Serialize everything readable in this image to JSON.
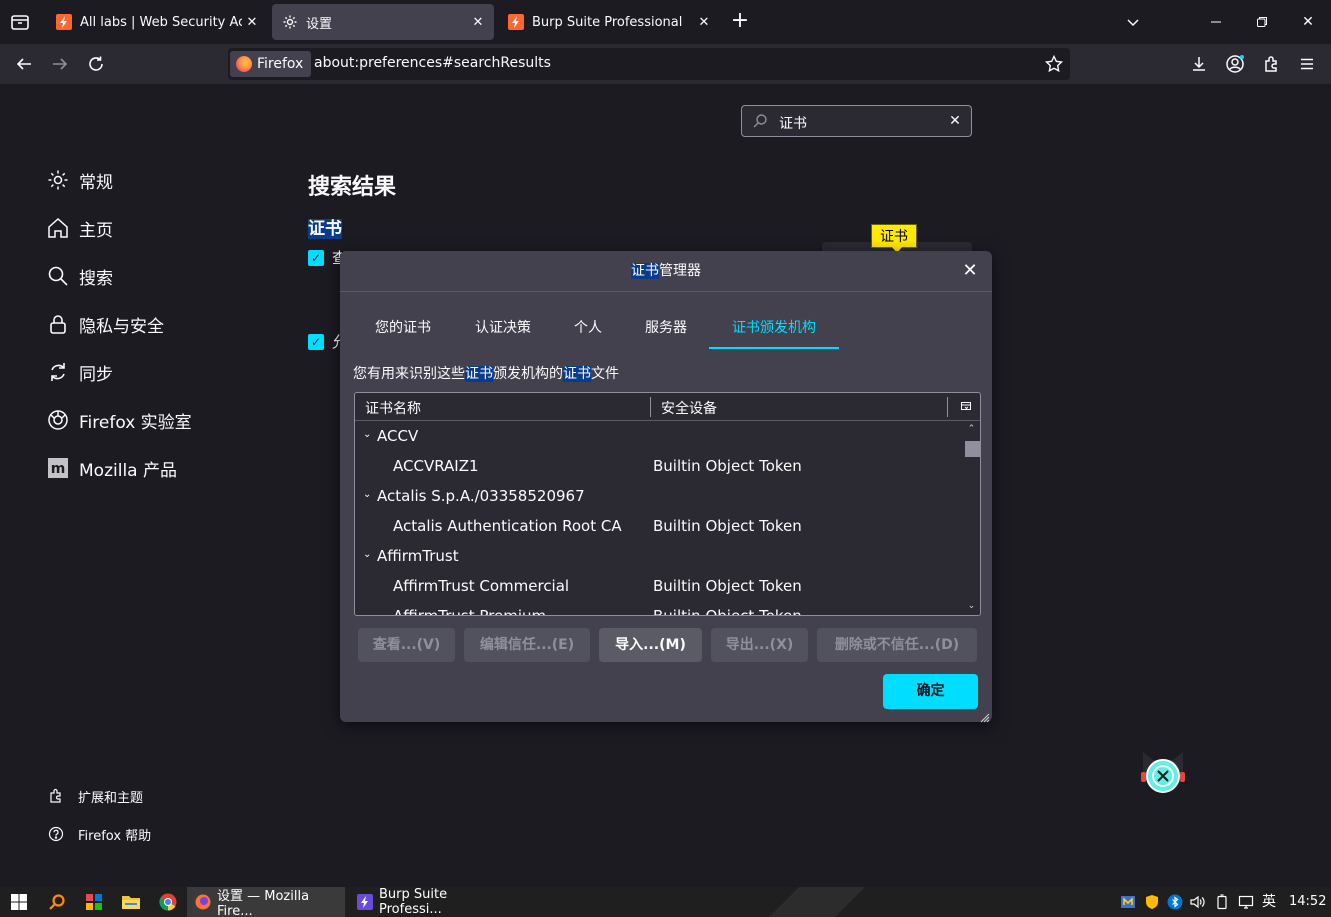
{
  "browser": {
    "tabs": [
      {
        "title": "All labs | Web Security Acade",
        "active": false
      },
      {
        "title": "设置",
        "active": true
      },
      {
        "title": "Burp Suite Professional",
        "active": false
      }
    ],
    "identity_label": "Firefox",
    "url": "about:preferences#searchResults"
  },
  "prefs": {
    "search_value": "证书",
    "sidebar": [
      {
        "label": "常规",
        "icon": "gear-icon"
      },
      {
        "label": "主页",
        "icon": "home-icon"
      },
      {
        "label": "搜索",
        "icon": "search-icon"
      },
      {
        "label": "隐私与安全",
        "icon": "lock-icon"
      },
      {
        "label": "同步",
        "icon": "sync-icon"
      },
      {
        "label": "Firefox 实验室",
        "icon": "labs-icon"
      },
      {
        "label": "Mozilla 产品",
        "icon": "mozilla-icon"
      }
    ],
    "footer": [
      {
        "label": "扩展和主题",
        "icon": "puzzle-icon"
      },
      {
        "label": "Firefox 帮助",
        "icon": "help-icon"
      }
    ],
    "results_title": "搜索结果",
    "cert_heading": "证书",
    "check1_label": "查",
    "check2_label": "允",
    "tooltip": "证书"
  },
  "dialog": {
    "title_hl": "证书",
    "title_rest": "管理器",
    "tabs": [
      "您的证书",
      "认证决策",
      "个人",
      "服务器",
      "证书颁发机构"
    ],
    "selected_tab": 4,
    "desc": {
      "a": "您有用来识别这些",
      "hl1": "证书",
      "b": "颁发机构的",
      "hl2": "证书",
      "c": "文件"
    },
    "columns": [
      "证书名称",
      "安全设备"
    ],
    "rows": [
      {
        "type": "group",
        "name": "ACCV",
        "device": ""
      },
      {
        "type": "item",
        "name": "ACCVRAIZ1",
        "device": "Builtin Object Token"
      },
      {
        "type": "group",
        "name": "Actalis S.p.A./03358520967",
        "device": ""
      },
      {
        "type": "item",
        "name": "Actalis Authentication Root CA",
        "device": "Builtin Object Token"
      },
      {
        "type": "group",
        "name": "AffirmTrust",
        "device": ""
      },
      {
        "type": "item",
        "name": "AffirmTrust Commercial",
        "device": "Builtin Object Token"
      },
      {
        "type": "item",
        "name": "AffirmTrust Premium",
        "device": "Builtin Object Token"
      }
    ],
    "buttons": [
      {
        "label": "查看...(V)",
        "enabled": false
      },
      {
        "label": "编辑信任...(E)",
        "enabled": false
      },
      {
        "label": "导入...(M)",
        "enabled": true
      },
      {
        "label": "导出...(X)",
        "enabled": false
      },
      {
        "label": "删除或不信任...(D)",
        "enabled": false
      }
    ],
    "ok_label": "确定"
  },
  "taskbar": {
    "apps": [
      {
        "label": "设置 — Mozilla Fire..."
      },
      {
        "label": "Burp Suite Professi..."
      }
    ],
    "ime": "英",
    "time": "14:52"
  },
  "colors": {
    "accent": "#00ddff",
    "highlight": "#0a3c8c",
    "burp": "#ff6633"
  }
}
